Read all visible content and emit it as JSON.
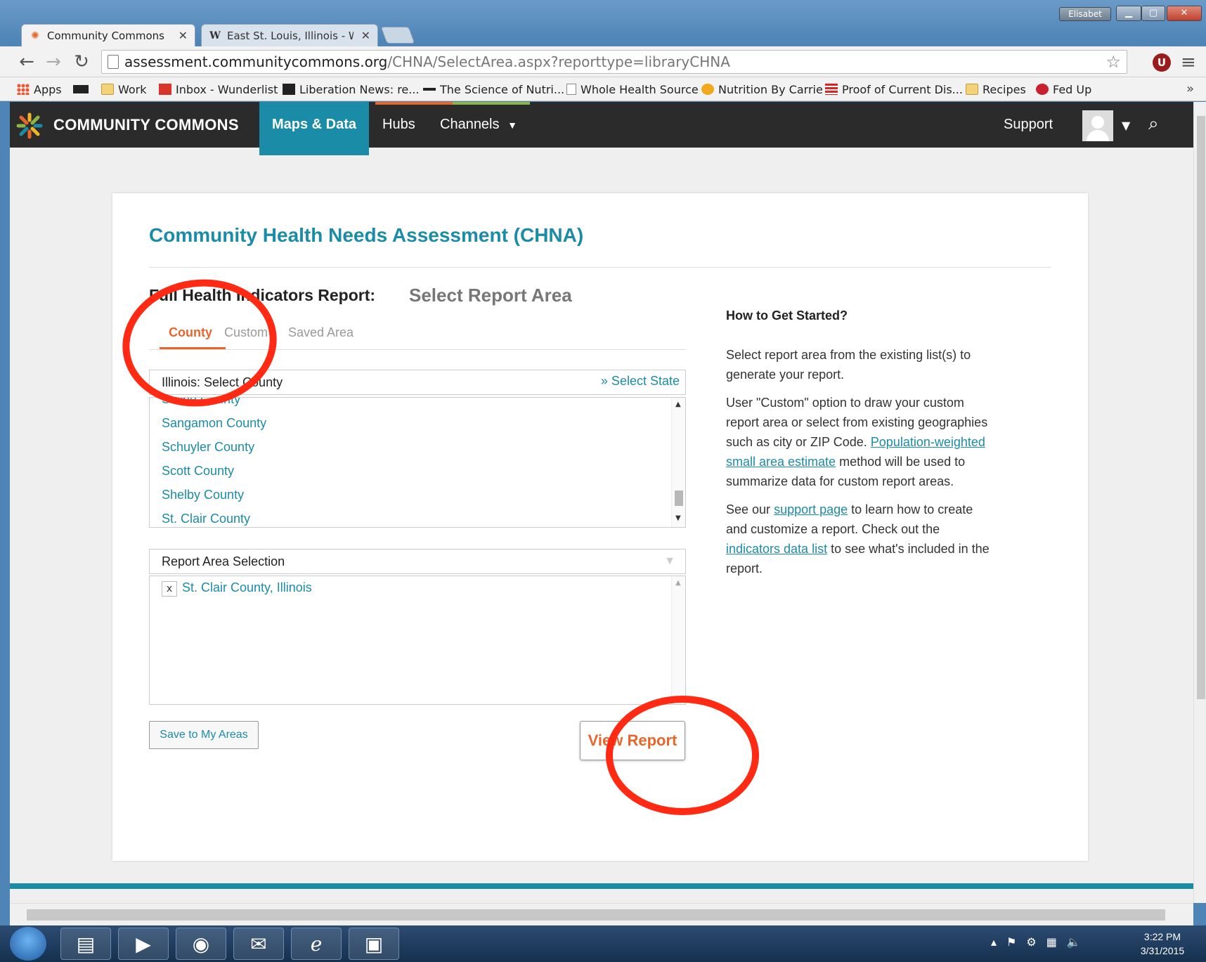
{
  "browser": {
    "tabs": [
      {
        "label": "Community Commons",
        "active": true
      },
      {
        "label": "East St. Louis, Illinois - Wi",
        "active": false
      }
    ],
    "user_label": "Elisabet",
    "url_host": "assessment.communitycommons.org",
    "url_path": "/CHNA/SelectArea.aspx?reporttype=libraryCHNA",
    "bookmarks": [
      "Apps",
      "Work",
      "Inbox - Wunderlist",
      "Liberation News: re...",
      "The Science of Nutri...",
      "Whole Health Source",
      "Nutrition By Carrie",
      "Proof of Current Dis...",
      "Recipes",
      "Fed Up"
    ],
    "bookmarks_overflow": "»",
    "extension_badge": "U"
  },
  "site": {
    "name": "COMMUNITY COMMONS",
    "nav": {
      "maps_data": "Maps & Data",
      "hubs": "Hubs",
      "channels": "Channels",
      "support": "Support"
    }
  },
  "page": {
    "title": "Community Health Needs Assessment (CHNA)",
    "report_name": "Full Health Indicators Report:",
    "report_sub": "Select Report Area",
    "area_tabs": [
      "County",
      "Custom",
      "Saved Area"
    ],
    "county_header": "Illinois: Select County",
    "select_state": "» Select State",
    "counties": [
      "Saline County",
      "Sangamon County",
      "Schuyler County",
      "Scott County",
      "Shelby County",
      "St. Clair County"
    ],
    "selection_header": "Report Area Selection",
    "selected_area": "St. Clair County, Illinois",
    "chip_remove": "x",
    "save_button": "Save to My Areas",
    "view_button": "View Report"
  },
  "help": {
    "title": "How to Get Started?",
    "p1": "Select report area from the existing list(s) to generate your report.",
    "p2_a": "User \"Custom\" option to draw your custom report area or select from existing geographies such as city or ZIP Code.",
    "p2_link": "Population-weighted small area estimate",
    "p2_b": "method will be used to summarize data for custom report areas.",
    "p3_a": "See our",
    "p3_link1": "support page",
    "p3_b": "to learn how to create and customize a report. Check out the",
    "p3_link2": "indicators data list",
    "p3_c": "to see what's included in the report."
  },
  "taskbar": {
    "time": "3:22 PM",
    "date": "3/31/2015"
  },
  "colors": {
    "brand_teal": "#1b8ca8",
    "accent_orange": "#e8662b",
    "annotation_red": "#ff2a14"
  }
}
